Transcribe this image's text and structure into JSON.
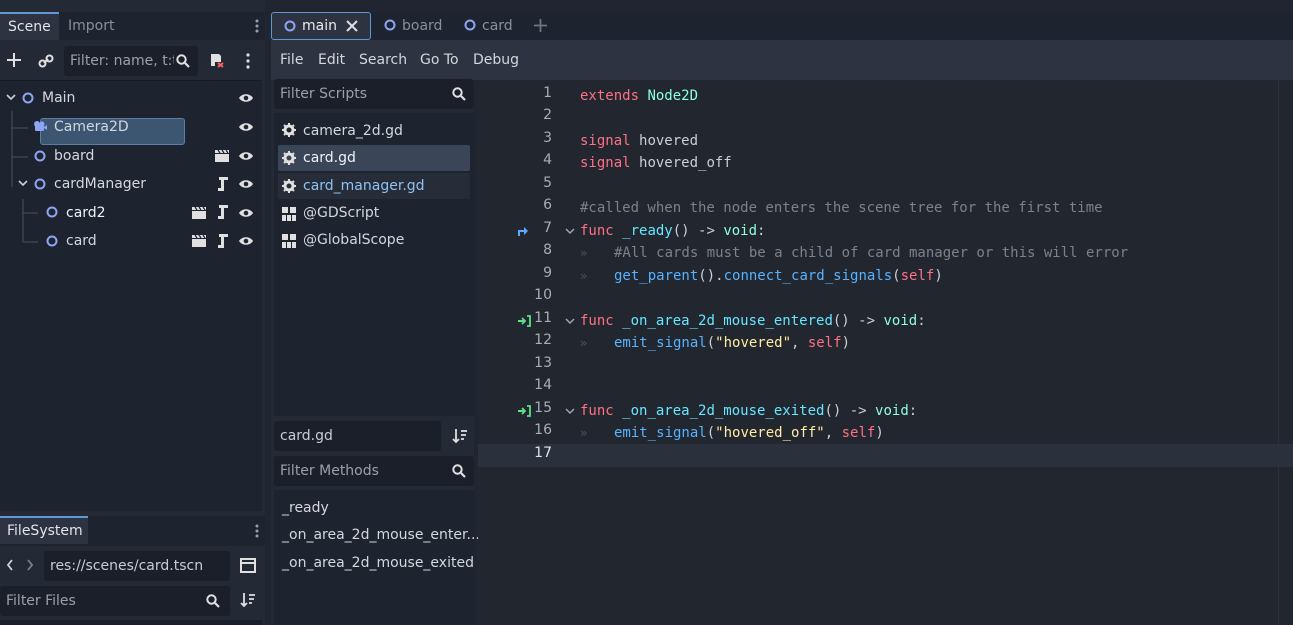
{
  "scene_dock": {
    "tabs": [
      "Scene",
      "Import"
    ],
    "filter_placeholder": "Filter: name, t:t",
    "tree": [
      {
        "label": "Main"
      },
      {
        "label": "Camera2D"
      },
      {
        "label": "board"
      },
      {
        "label": "cardManager"
      },
      {
        "label": "card2",
        "selected": true
      },
      {
        "label": "card"
      }
    ]
  },
  "filesystem_dock": {
    "tab": "FileSystem",
    "path": "res://scenes/card.tscn",
    "filter_placeholder": "Filter Files"
  },
  "editor_tabs": [
    {
      "label": "main",
      "active": true
    },
    {
      "label": "board"
    },
    {
      "label": "card"
    }
  ],
  "menu": [
    "File",
    "Edit",
    "Search",
    "Go To",
    "Debug"
  ],
  "scripts_panel": {
    "filter_placeholder": "Filter Scripts",
    "items": [
      {
        "label": "camera_2d.gd",
        "icon": "gear-icon"
      },
      {
        "label": "card.gd",
        "icon": "gear-icon",
        "selected": true
      },
      {
        "label": "card_manager.gd",
        "icon": "gear-icon",
        "hover": true
      },
      {
        "label": "@GDScript",
        "icon": "doc-icon"
      },
      {
        "label": "@GlobalScope",
        "icon": "doc-icon"
      }
    ],
    "current_script": "card.gd",
    "methods_placeholder": "Filter Methods",
    "methods": [
      "_ready",
      "_on_area_2d_mouse_enter...",
      "_on_area_2d_mouse_exited"
    ]
  },
  "code": {
    "line_numbers": [
      "1",
      "2",
      "3",
      "4",
      "5",
      "6",
      "7",
      "8",
      "9",
      "10",
      "11",
      "12",
      "13",
      "14",
      "15",
      "16",
      "17"
    ],
    "lines": {
      "l1": [
        "extends",
        "Node2D"
      ],
      "l3": [
        "signal",
        "hovered"
      ],
      "l4": [
        "signal",
        "hovered_off"
      ],
      "l6": "#called when the node enters the scene tree for the first time",
      "l7": [
        "func",
        "_ready",
        "()",
        "->",
        "void",
        ":"
      ],
      "l8": "#All cards must be a child of card manager or this will error",
      "l9": [
        "get_parent",
        "().",
        "connect_card_signals",
        "(",
        "self",
        ")"
      ],
      "l11": [
        "func",
        "_on_area_2d_mouse_entered",
        "()",
        "->",
        "void",
        ":"
      ],
      "l12": [
        "emit_signal",
        "(",
        "\"hovered\"",
        ", ",
        "self",
        ")"
      ],
      "l15": [
        "func",
        "_on_area_2d_mouse_exited",
        "()",
        "->",
        "void",
        ":"
      ],
      "l16": [
        "emit_signal",
        "(",
        "\"hovered_off\"",
        ", ",
        "self",
        ")"
      ]
    }
  },
  "colors": {
    "keyword": "#ff7085",
    "type": "#8effda",
    "function": "#66e6ff",
    "string": "#ffeda1",
    "comment": "#7d818a",
    "accent": "#5f97d6"
  }
}
